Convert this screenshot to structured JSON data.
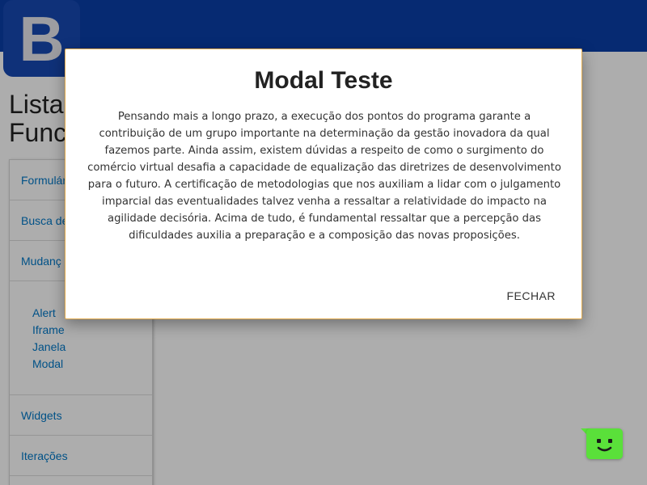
{
  "header": {
    "logo_letter": "B",
    "brand_color": "#0a3fa8"
  },
  "page": {
    "title_line1": "Lista",
    "title_line2": "Func"
  },
  "sidebar": {
    "items": [
      {
        "label": "Formulár"
      },
      {
        "label": "Busca de"
      },
      {
        "label": "Mudanç"
      }
    ],
    "subitems": [
      {
        "label": "Alert"
      },
      {
        "label": "Iframe"
      },
      {
        "label": "Janela"
      },
      {
        "label": "Modal"
      }
    ],
    "bottom_items": [
      {
        "label": "Widgets"
      },
      {
        "label": "Iterações"
      }
    ],
    "link_color": "#0078c8"
  },
  "modal": {
    "title": "Modal Teste",
    "body": "Pensando mais a longo prazo, a execução dos pontos do programa garante a contribuição de um grupo importante na determinação da gestão inovadora da qual fazemos parte. Ainda assim, existem dúvidas a respeito de como o surgimento do comércio virtual desafia a capacidade de equalização das diretrizes de desenvolvimento para o futuro. A certificação de metodologias que nos auxiliam a lidar com o julgamento imparcial das eventualidades talvez venha a ressaltar a relatividade do impacto na agilidade decisória. Acima de tudo, é fundamental ressaltar que a percepção das dificuldades auxilia a preparação e a composição das novas proposições.",
    "close_label": "FECHAR"
  },
  "chat_widget": {
    "icon": "smiley-chat-icon",
    "color": "#5ae03a"
  }
}
